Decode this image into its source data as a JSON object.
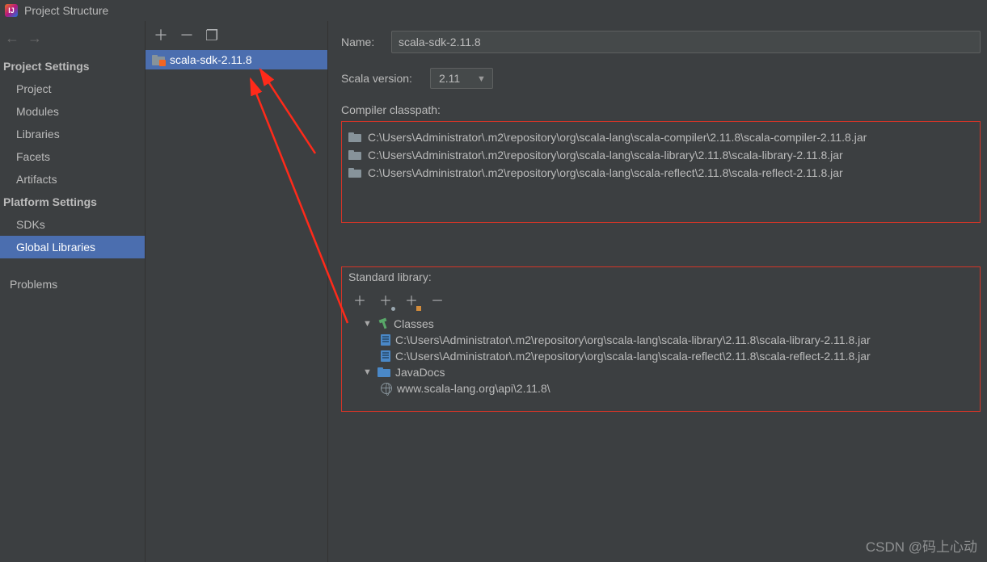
{
  "window": {
    "title": "Project Structure"
  },
  "sidebar": {
    "back_icon": "←",
    "fwd_icon": "→",
    "section1": "Project Settings",
    "items1": [
      "Project",
      "Modules",
      "Libraries",
      "Facets",
      "Artifacts"
    ],
    "section2": "Platform Settings",
    "items2": [
      "SDKs",
      "Global Libraries"
    ],
    "selected": "Global Libraries",
    "problems": "Problems"
  },
  "mid": {
    "add": "＋",
    "remove": "－",
    "copy": "❐",
    "item": "scala-sdk-2.11.8"
  },
  "detail": {
    "name_label": "Name:",
    "name_value": "scala-sdk-2.11.8",
    "scala_label": "Scala version:",
    "scala_value": "2.11",
    "compiler_label": "Compiler classpath:",
    "compiler_paths": [
      "C:\\Users\\Administrator\\.m2\\repository\\org\\scala-lang\\scala-compiler\\2.11.8\\scala-compiler-2.11.8.jar",
      "C:\\Users\\Administrator\\.m2\\repository\\org\\scala-lang\\scala-library\\2.11.8\\scala-library-2.11.8.jar",
      "C:\\Users\\Administrator\\.m2\\repository\\org\\scala-lang\\scala-reflect\\2.11.8\\scala-reflect-2.11.8.jar"
    ],
    "std_label": "Standard library:",
    "classes_label": "Classes",
    "classes_paths": [
      "C:\\Users\\Administrator\\.m2\\repository\\org\\scala-lang\\scala-library\\2.11.8\\scala-library-2.11.8.jar",
      "C:\\Users\\Administrator\\.m2\\repository\\org\\scala-lang\\scala-reflect\\2.11.8\\scala-reflect-2.11.8.jar"
    ],
    "javadocs_label": "JavaDocs",
    "javadocs_path": "www.scala-lang.org\\api\\2.11.8\\"
  },
  "watermark": "CSDN @码上心动"
}
